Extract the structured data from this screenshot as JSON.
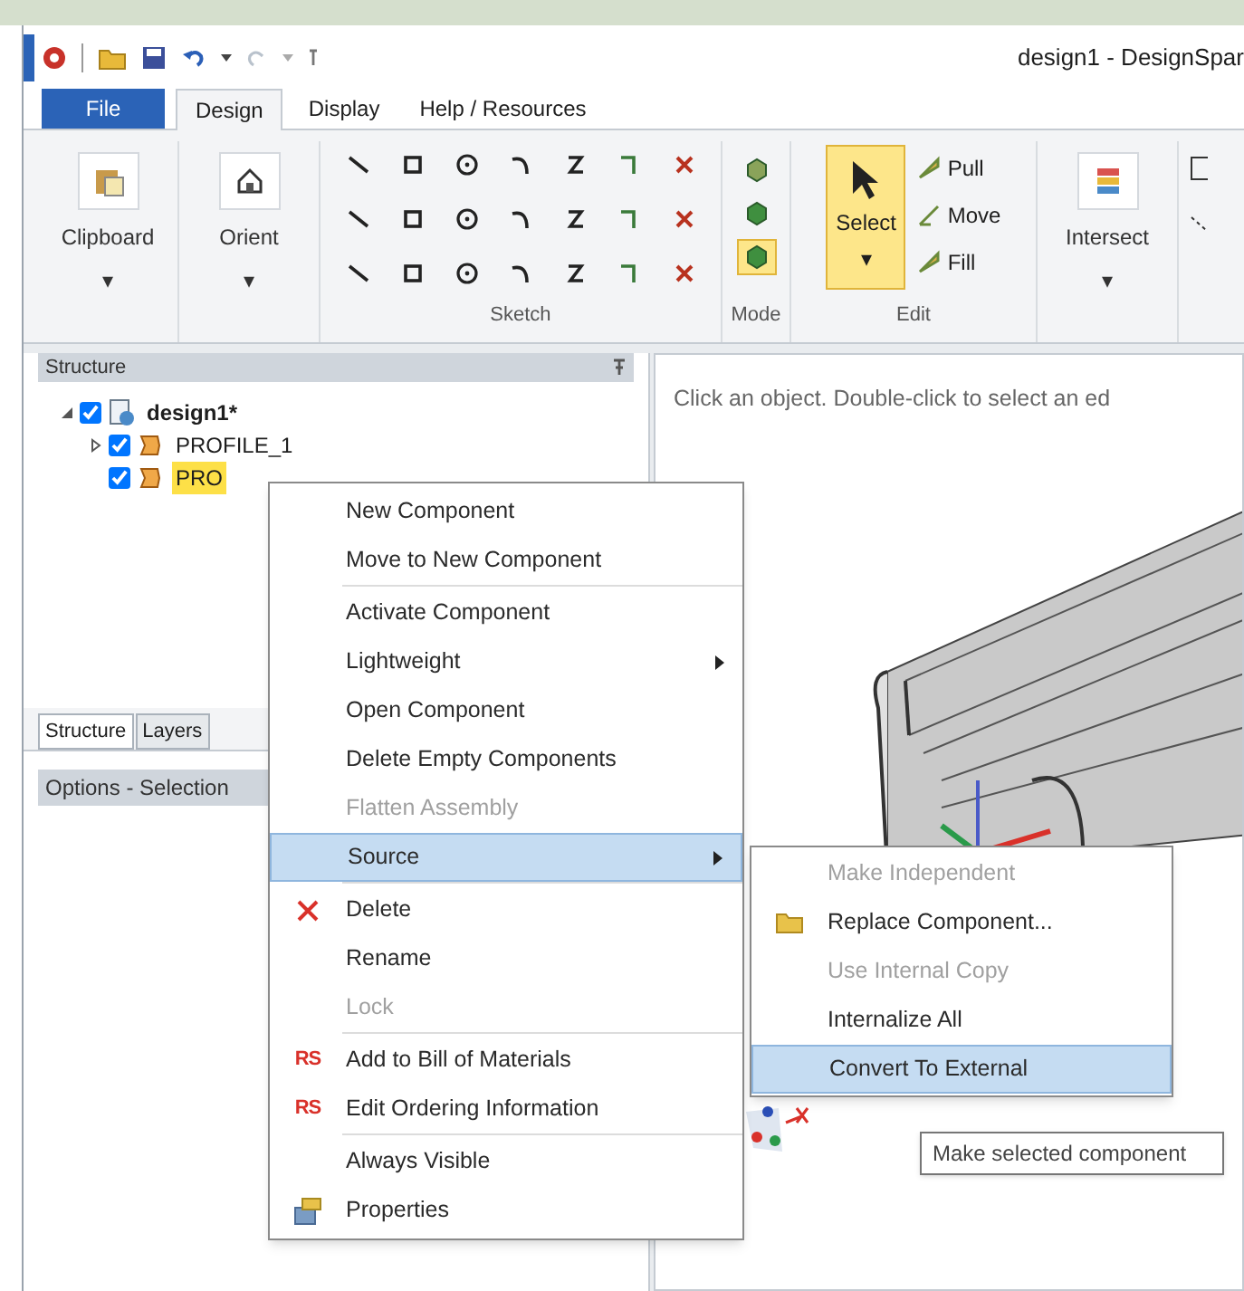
{
  "window": {
    "title": "design1 - DesignSpar"
  },
  "ribbon_tabs": [
    {
      "label": "File",
      "kind": "file",
      "selected": false
    },
    {
      "label": "Design",
      "kind": "tab",
      "selected": true
    },
    {
      "label": "Display",
      "kind": "tab",
      "selected": false
    },
    {
      "label": "Help / Resources",
      "kind": "tab",
      "selected": false
    }
  ],
  "ribbon": {
    "clipboard": {
      "label": "Clipboard",
      "caret": "▾"
    },
    "orient": {
      "label": "Orient",
      "caret": "▾"
    },
    "sketch": {
      "label": "Sketch"
    },
    "mode": {
      "label": "Mode",
      "buttons": [
        {
          "selected": false
        },
        {
          "selected": false
        },
        {
          "selected": true
        }
      ]
    },
    "edit": {
      "label": "Edit",
      "select": {
        "label": "Select",
        "caret": "▾",
        "selected": true
      },
      "tools": [
        "Pull",
        "Move",
        "Fill"
      ]
    },
    "intersect": {
      "label": "Intersect",
      "caret": "▾"
    }
  },
  "structure": {
    "title": "Structure",
    "tree": [
      {
        "label": "design1*",
        "checked": true,
        "expanded": true,
        "children": [
          {
            "label": "PROFILE_1",
            "checked": true,
            "expanded": false,
            "selected": false
          },
          {
            "label": "PRO",
            "checked": true,
            "selected": true
          }
        ]
      }
    ],
    "tabs": [
      {
        "label": "Structure",
        "selected": true
      },
      {
        "label": "Layers",
        "selected": false
      }
    ]
  },
  "options": {
    "title": "Options - Selection"
  },
  "viewport": {
    "hint": "Click an object. Double-click to select an ed"
  },
  "context_menu": {
    "groups": [
      [
        {
          "label": "New Component",
          "kind": "plain",
          "disabled": false,
          "highlighted": false,
          "submenu": false
        },
        {
          "label": "Move to New Component",
          "kind": "plain",
          "disabled": false,
          "highlighted": false,
          "submenu": false
        }
      ],
      [
        {
          "label": "Activate Component",
          "kind": "plain",
          "disabled": false,
          "highlighted": false,
          "submenu": false
        },
        {
          "label": "Lightweight",
          "kind": "plain",
          "disabled": false,
          "highlighted": false,
          "submenu": true
        },
        {
          "label": "Open Component",
          "kind": "plain",
          "disabled": false,
          "highlighted": false,
          "submenu": false
        },
        {
          "label": "Delete Empty Components",
          "kind": "plain",
          "disabled": false,
          "highlighted": false,
          "submenu": false
        },
        {
          "label": "Flatten Assembly",
          "kind": "plain",
          "disabled": true,
          "highlighted": false,
          "submenu": false
        },
        {
          "label": "Source",
          "kind": "plain",
          "disabled": false,
          "highlighted": true,
          "submenu": true
        }
      ],
      [
        {
          "label": "Delete",
          "kind": "delete",
          "disabled": false,
          "highlighted": false,
          "submenu": false
        },
        {
          "label": "Rename",
          "kind": "plain",
          "disabled": false,
          "highlighted": false,
          "submenu": false
        },
        {
          "label": "Lock",
          "kind": "plain",
          "disabled": true,
          "highlighted": false,
          "submenu": false
        }
      ],
      [
        {
          "label": "Add to Bill of Materials",
          "kind": "rs",
          "badge": "RS",
          "disabled": false,
          "highlighted": false,
          "submenu": false
        },
        {
          "label": "Edit Ordering Information",
          "kind": "rs",
          "badge": "RS",
          "disabled": false,
          "highlighted": false,
          "submenu": false
        }
      ],
      [
        {
          "label": "Always Visible",
          "kind": "plain",
          "disabled": false,
          "highlighted": false,
          "submenu": false
        },
        {
          "label": "Properties",
          "kind": "properties",
          "disabled": false,
          "highlighted": false,
          "submenu": false
        }
      ]
    ]
  },
  "submenu": {
    "items": [
      {
        "label": "Make Independent",
        "kind": "plain",
        "disabled": true,
        "highlighted": false
      },
      {
        "label": "Replace Component...",
        "kind": "folder",
        "disabled": false,
        "highlighted": false
      },
      {
        "label": "Use Internal Copy",
        "kind": "plain",
        "disabled": true,
        "highlighted": false
      },
      {
        "label": "Internalize All",
        "kind": "plain",
        "disabled": false,
        "highlighted": false
      },
      {
        "label": "Convert To External",
        "kind": "plain",
        "disabled": false,
        "highlighted": true
      }
    ]
  },
  "tooltip": {
    "text": "Make selected component"
  }
}
